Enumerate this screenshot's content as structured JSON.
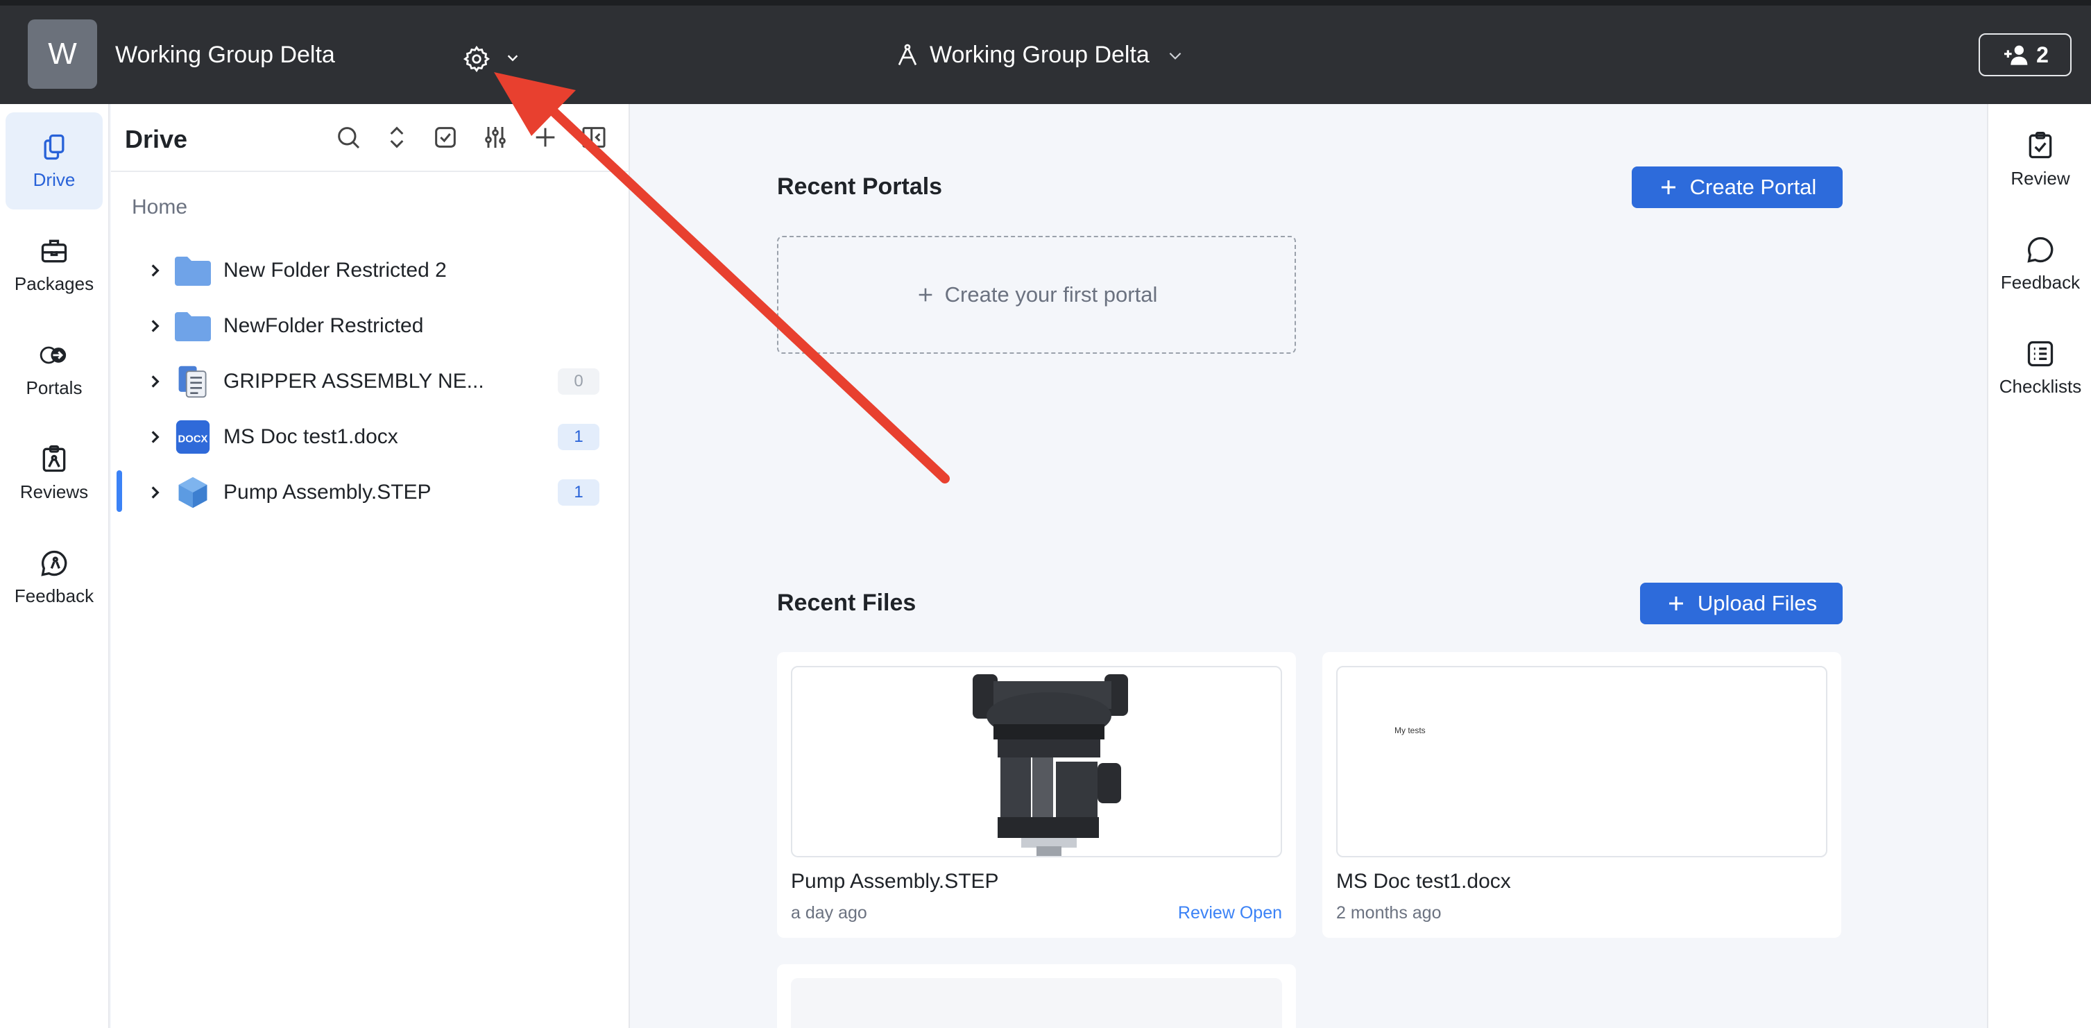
{
  "topbar": {
    "avatar_letter": "W",
    "workspace_name": "Working Group Delta",
    "center_title": "Working Group Delta",
    "invite_count": "2"
  },
  "rail": {
    "items": [
      {
        "label": "Drive",
        "icon": "drive-icon"
      },
      {
        "label": "Packages",
        "icon": "briefcase-icon"
      },
      {
        "label": "Portals",
        "icon": "portal-icon"
      },
      {
        "label": "Reviews",
        "icon": "review-clipboard-icon"
      },
      {
        "label": "Feedback",
        "icon": "feedback-icon"
      }
    ]
  },
  "drive": {
    "title": "Drive",
    "breadcrumb": "Home",
    "items": [
      {
        "name": "New Folder Restricted 2",
        "type": "folder",
        "count": ""
      },
      {
        "name": "NewFolder Restricted",
        "type": "folder",
        "count": ""
      },
      {
        "name": "GRIPPER ASSEMBLY NE...",
        "type": "document",
        "count": "0"
      },
      {
        "name": "MS Doc test1.docx",
        "type": "docx",
        "count": "1"
      },
      {
        "name": "Pump Assembly.STEP",
        "type": "cad",
        "count": "1"
      }
    ],
    "docx_badge": "DOCX"
  },
  "main": {
    "portals": {
      "title": "Recent Portals",
      "create_label": "Create Portal",
      "empty_label": "Create your first portal"
    },
    "files": {
      "title": "Recent Files",
      "upload_label": "Upload Files",
      "cards": [
        {
          "name": "Pump Assembly.STEP",
          "time": "a day ago",
          "status": "Review Open"
        },
        {
          "name": "MS Doc test1.docx",
          "time": "2 months ago",
          "status": "",
          "preview_text": "My tests"
        }
      ]
    }
  },
  "rrail": {
    "items": [
      {
        "label": "Review",
        "icon": "review-icon"
      },
      {
        "label": "Feedback",
        "icon": "chat-bubble-icon"
      },
      {
        "label": "Checklists",
        "icon": "checklist-icon"
      }
    ]
  },
  "colors": {
    "topbar": "#2e3034",
    "primary": "#2d6bdb",
    "annotation_arrow": "#e8402f"
  }
}
